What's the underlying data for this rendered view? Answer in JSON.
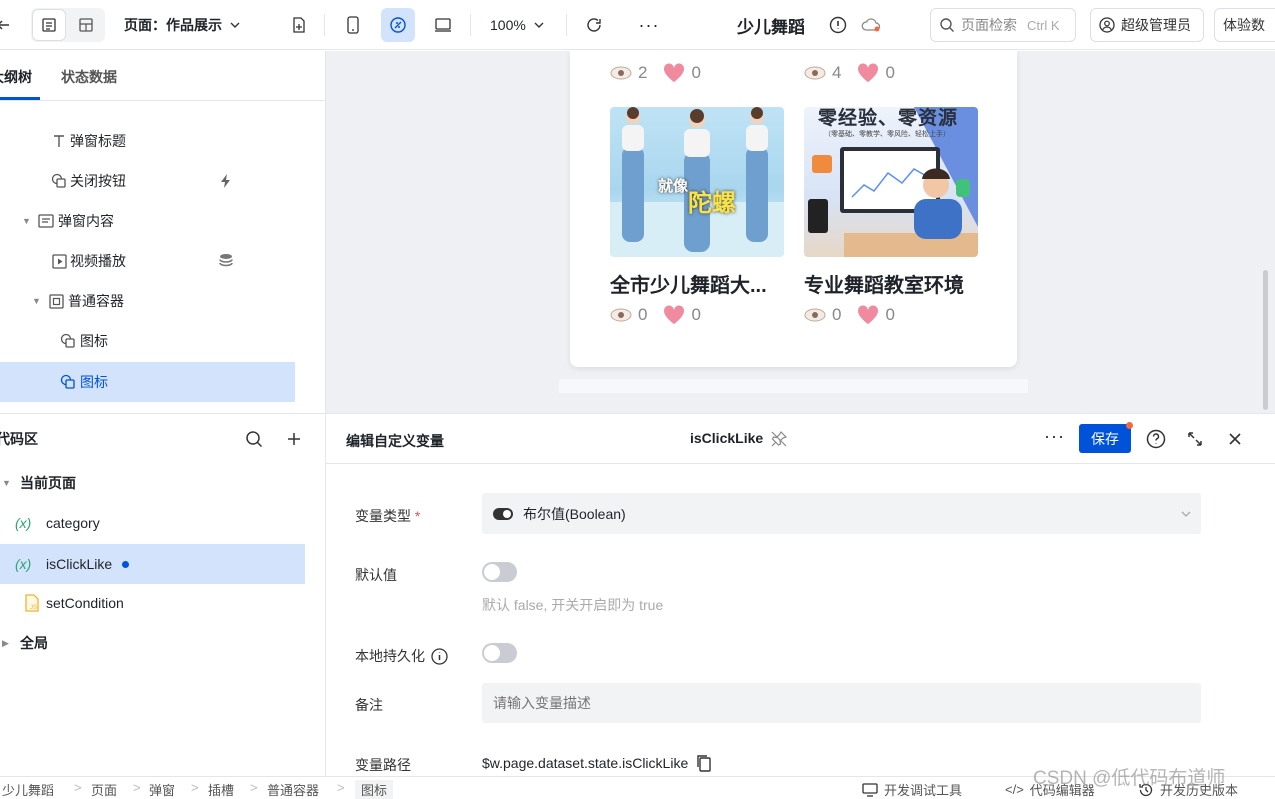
{
  "topbar": {
    "page_label": "页面：作品展示",
    "zoom": "100%",
    "app_name": "少儿舞蹈",
    "search_placeholder": "页面检索",
    "search_shortcut": "Ctrl K",
    "user_label": "超级管理员",
    "trial_label": "体验数"
  },
  "left": {
    "tabs": [
      "大纲树",
      "状态数据"
    ],
    "tree": [
      {
        "label": "弹窗标题",
        "icon": "text-icon"
      },
      {
        "label": "关闭按钮",
        "icon": "component-icon"
      },
      {
        "label": "弹窗内容",
        "icon": "panel-icon"
      },
      {
        "label": "视频播放",
        "icon": "play-icon"
      },
      {
        "label": "普通容器",
        "icon": "container-icon"
      },
      {
        "label": "图标",
        "icon": "component-icon"
      },
      {
        "label": "图标",
        "icon": "component-icon"
      }
    ],
    "code_title": "代码区",
    "code_items": [
      {
        "label": "当前页面"
      },
      {
        "label": "category",
        "prefix": "(x)"
      },
      {
        "label": "isClickLike",
        "prefix": "(x)"
      },
      {
        "label": "setCondition",
        "prefix": "JS"
      },
      {
        "label": "全局"
      }
    ]
  },
  "canvas": {
    "top_meta": [
      {
        "views": "2",
        "likes": "0"
      },
      {
        "views": "4",
        "likes": "0"
      }
    ],
    "cards": [
      {
        "title": "全市少儿舞蹈大...",
        "views": "0",
        "likes": "0",
        "overlay1": "就像",
        "overlay2": "陀螺"
      },
      {
        "title": "专业舞蹈教室环境",
        "views": "0",
        "likes": "0",
        "banner": "零经验、零资源",
        "subbanner": "（零基础、零教学、零风险、轻松上手）"
      }
    ]
  },
  "editor": {
    "title": "编辑自定义变量",
    "var_name": "isClickLike",
    "save": "保存",
    "type_label": "变量类型",
    "required_mark": "*",
    "type_value": "布尔值(Boolean)",
    "default_label": "默认值",
    "default_hint": "默认 false, 开关开启即为 true",
    "persist_label": "本地持久化",
    "note_label": "备注",
    "note_placeholder": "请输入变量描述",
    "path_label": "变量路径",
    "path_value": "$w.page.dataset.state.isClickLike"
  },
  "statusbar": {
    "crumbs": [
      "少儿舞蹈",
      "页面",
      "弹窗",
      "插槽",
      "普通容器",
      "图标"
    ],
    "tools": [
      "开发调试工具",
      "代码编辑器",
      "开发历史版本"
    ],
    "watermark": "CSDN @低代码布道师"
  },
  "colors": {
    "accent": "#0052d9",
    "selected": "#d4e3fc",
    "like": "#f08a9e"
  }
}
